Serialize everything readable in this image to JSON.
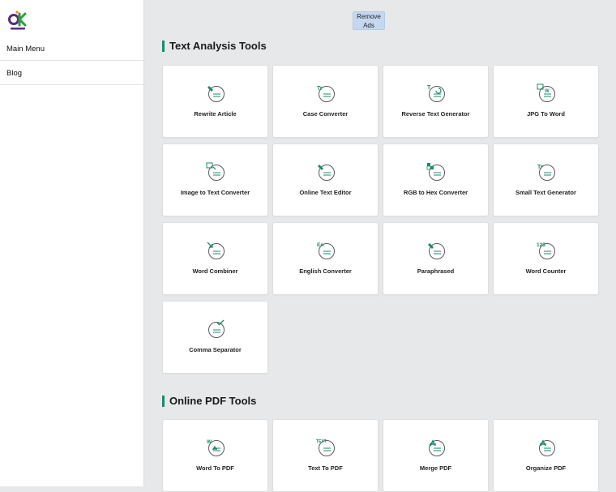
{
  "brand": {
    "logo_icon": "ok-logo-icon",
    "colors": {
      "accent": "#1a8a6c",
      "logo_purple": "#5a2a82",
      "logo_green": "#2f9b3d",
      "logo_orange": "#e58a1f"
    }
  },
  "sidebar": {
    "items": [
      {
        "label": "Main Menu"
      },
      {
        "label": "Blog"
      }
    ]
  },
  "header": {
    "remove_ads_line1": "Remove",
    "remove_ads_line2": "Ads"
  },
  "sections": [
    {
      "title": "Text Analysis Tools",
      "tools": [
        {
          "label": "Rewrite Article",
          "icon": "pen-icon"
        },
        {
          "label": "Case Converter",
          "icon": "tt-icon"
        },
        {
          "label": "Reverse Text Generator",
          "icon": "reverse-text-icon"
        },
        {
          "label": "JPG To Word",
          "icon": "image-word-icon"
        },
        {
          "label": "Image to Text Converter",
          "icon": "image-text-icon"
        },
        {
          "label": "Online Text Editor",
          "icon": "pen-icon"
        },
        {
          "label": "RGB to Hex Converter",
          "icon": "rgb-hex-icon"
        },
        {
          "label": "Small Text Generator",
          "icon": "tt-icon"
        },
        {
          "label": "Word Combiner",
          "icon": "combine-arrow-icon"
        },
        {
          "label": "English Converter",
          "icon": "en-icon"
        },
        {
          "label": "Paraphrased",
          "icon": "pen-icon"
        },
        {
          "label": "Word Counter",
          "icon": "numbers-icon"
        },
        {
          "label": "Comma Separator",
          "icon": "check-icon"
        }
      ]
    },
    {
      "title": "Online PDF Tools",
      "tools": [
        {
          "label": "Word To PDF",
          "icon": "word-pdf-icon"
        },
        {
          "label": "Text To PDF",
          "icon": "text-pdf-icon"
        },
        {
          "label": "Merge PDF",
          "icon": "pdf-icon"
        },
        {
          "label": "Organize PDF",
          "icon": "pdf-icon"
        }
      ]
    }
  ]
}
